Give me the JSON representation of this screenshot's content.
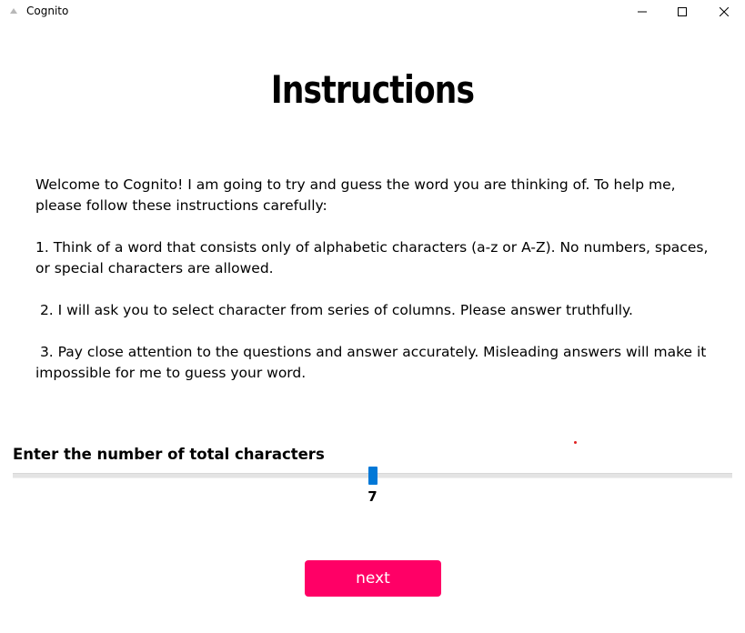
{
  "window": {
    "title": "Cognito",
    "minimize_icon": "minimize-icon",
    "maximize_icon": "maximize-icon",
    "close_icon": "close-icon"
  },
  "page": {
    "heading": "Instructions",
    "paragraphs": [
      "Welcome to Cognito! I am going to try and guess the word you are thinking of. To help me, please follow these instructions carefully:",
      "1. Think of a word that consists only of alphabetic characters (a-z or A-Z). No numbers, spaces, or special characters are allowed.",
      " 2. I will ask you to select character from series of columns. Please answer truthfully.",
      " 3. Pay close attention to the questions and answer accurately. Misleading answers will make it impossible for me to guess your word."
    ]
  },
  "slider": {
    "label": "Enter the number of total characters",
    "value": "7",
    "fraction": 0.5
  },
  "buttons": {
    "next_label": "next"
  },
  "colors": {
    "accent_button": "#ff0066",
    "slider_thumb": "#0078d7"
  }
}
